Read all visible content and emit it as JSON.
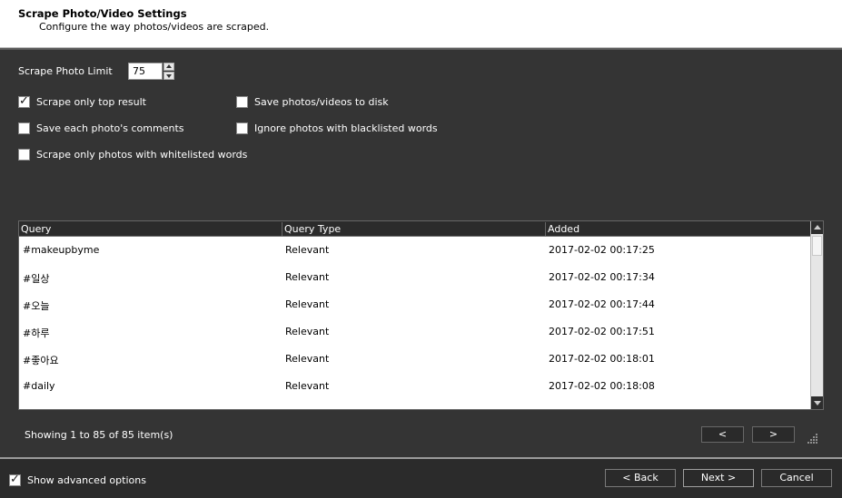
{
  "header": {
    "title": "Scrape Photo/Video Settings",
    "subtitle": "Configure the way photos/videos are scraped."
  },
  "limit": {
    "label": "Scrape Photo Limit",
    "value": "75"
  },
  "options": {
    "scrape_top_result": {
      "label": "Scrape only top result",
      "checked": true
    },
    "save_to_disk": {
      "label": "Save photos/videos to disk",
      "checked": false
    },
    "save_comments": {
      "label": "Save each photo's comments",
      "checked": false
    },
    "ignore_blacklisted": {
      "label": "Ignore photos with blacklisted words",
      "checked": false
    },
    "whitelisted_only": {
      "label": "Scrape only photos with whitelisted words",
      "checked": false
    }
  },
  "table": {
    "columns": [
      "Query",
      "Query Type",
      "Added"
    ],
    "rows": [
      [
        "#makeupbyme",
        "Relevant",
        "2017-02-02 00:17:25"
      ],
      [
        "#일상",
        "Relevant",
        "2017-02-02 00:17:34"
      ],
      [
        "#오늘",
        "Relevant",
        "2017-02-02 00:17:44"
      ],
      [
        "#하루",
        "Relevant",
        "2017-02-02 00:17:51"
      ],
      [
        "#좋아요",
        "Relevant",
        "2017-02-02 00:18:01"
      ],
      [
        "#daily",
        "Relevant",
        "2017-02-02 00:18:08"
      ]
    ]
  },
  "pagination": {
    "status": "Showing 1 to 85 of 85 item(s)",
    "prev": "<",
    "next": ">"
  },
  "footer": {
    "advanced": {
      "label": "Show advanced options",
      "checked": true
    },
    "back": "< Back",
    "next": "Next >",
    "cancel": "Cancel"
  },
  "colors": {
    "background": "#343434",
    "footer": "#2b2b2b",
    "header": "#ffffff"
  }
}
